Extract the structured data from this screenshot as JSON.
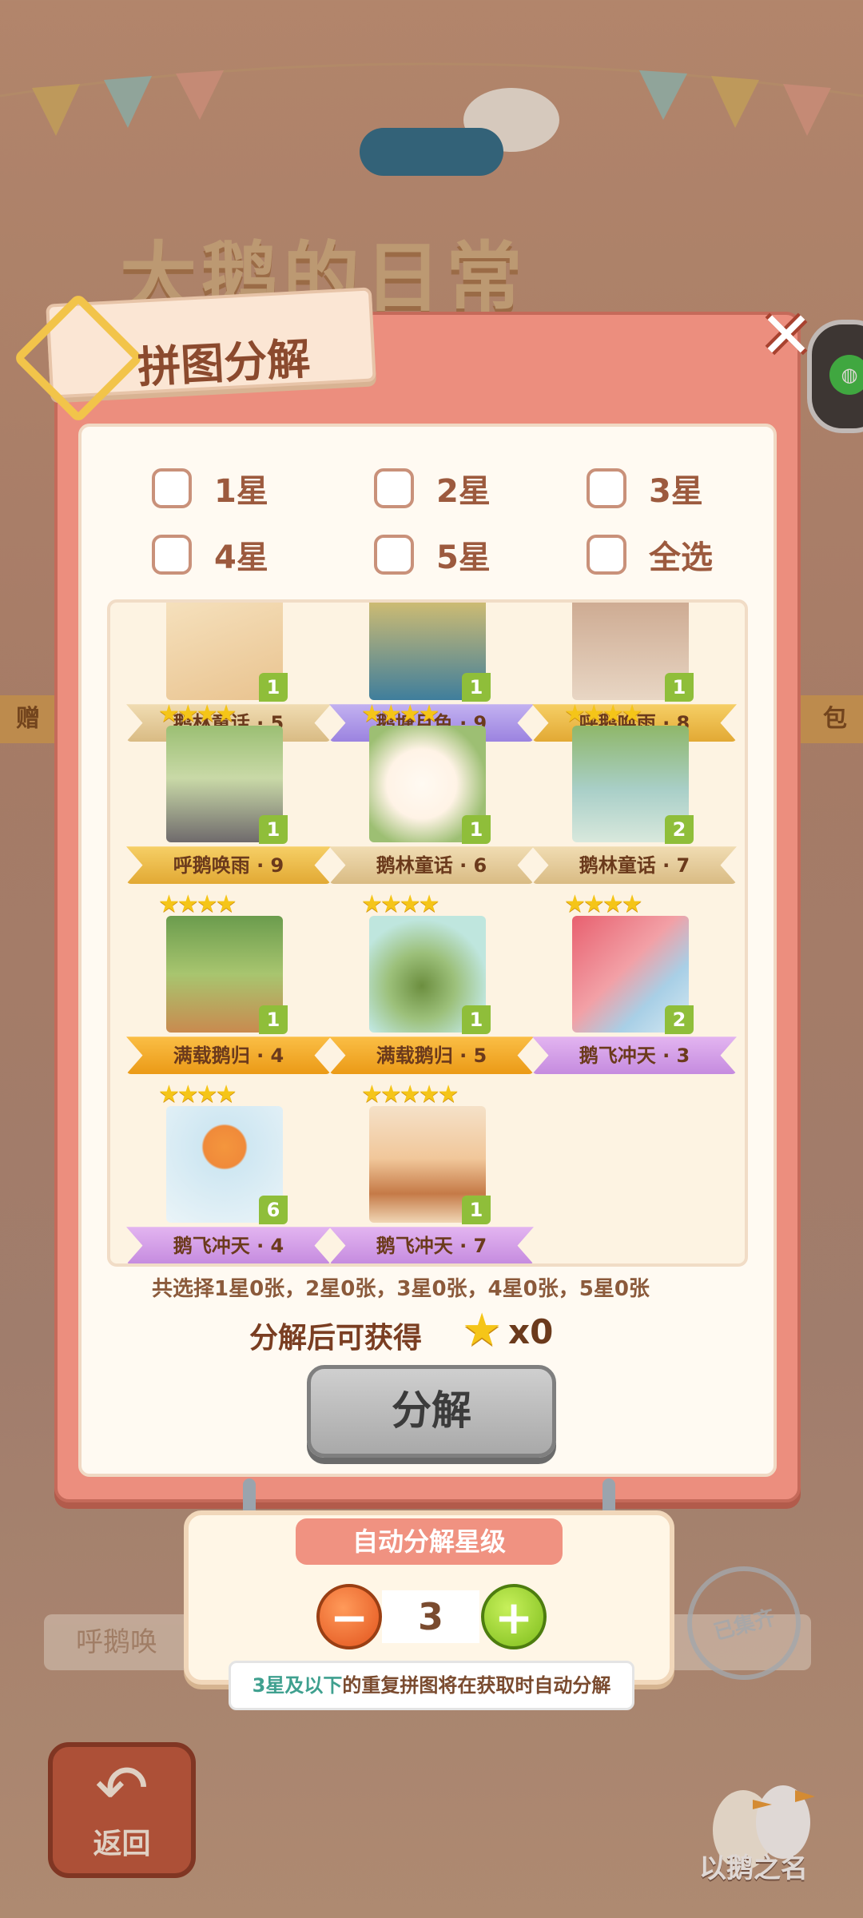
{
  "background": {
    "title": "大鹅的日常",
    "left_side_text": "赠",
    "right_side_text": "包",
    "bottom_strip_text": "呼鹅唤",
    "collected_stamp": "已集齐",
    "back_label": "返回",
    "brand_text": "以鹅之名"
  },
  "dialog": {
    "title": "拼图分解",
    "filters": [
      {
        "label": "1星",
        "checked": false
      },
      {
        "label": "2星",
        "checked": false
      },
      {
        "label": "3星",
        "checked": false
      },
      {
        "label": "4星",
        "checked": false
      },
      {
        "label": "5星",
        "checked": false
      },
      {
        "label": "全选",
        "checked": false
      }
    ],
    "cards": [
      {
        "name": "鹅林童话 · 5",
        "count": "1",
        "stars": 0,
        "ribbon": "tan"
      },
      {
        "name": "鹅塘月色 · 9",
        "count": "1",
        "stars": 0,
        "ribbon": "purple"
      },
      {
        "name": "呼鹅唤雨 · 8",
        "count": "1",
        "stars": 0,
        "ribbon": "gold"
      },
      {
        "name": "呼鹅唤雨 · 9",
        "count": "1",
        "stars": 4,
        "ribbon": "gold"
      },
      {
        "name": "鹅林童话 · 6",
        "count": "1",
        "stars": 4,
        "ribbon": "tan"
      },
      {
        "name": "鹅林童话 · 7",
        "count": "2",
        "stars": 4,
        "ribbon": "tan"
      },
      {
        "name": "满载鹅归 · 4",
        "count": "1",
        "stars": 4,
        "ribbon": "orange"
      },
      {
        "name": "满载鹅归 · 5",
        "count": "1",
        "stars": 4,
        "ribbon": "orange"
      },
      {
        "name": "鹅飞冲天 · 3",
        "count": "2",
        "stars": 4,
        "ribbon": "pink"
      },
      {
        "name": "鹅飞冲天 · 4",
        "count": "6",
        "stars": 4,
        "ribbon": "pink"
      },
      {
        "name": "鹅飞冲天 · 7",
        "count": "1",
        "stars": 5,
        "ribbon": "pink"
      }
    ],
    "summary": "共选择1星0张，2星0张，3星0张，4星0张，5星0张",
    "reward_label": "分解后可获得",
    "reward_count": "x0",
    "decompose_label": "分解"
  },
  "auto_decompose": {
    "title": "自动分解星级",
    "level": "3",
    "hint_accent": "3星及以下",
    "hint_rest": "的重复拼图将在获取时自动分解"
  },
  "colors": {
    "dialog_bg": "#ec8e7e",
    "accent_green": "#8fbe3a",
    "star_gold": "#f5c518",
    "minus_orange": "#e2541d",
    "plus_green": "#7ebd1c"
  }
}
